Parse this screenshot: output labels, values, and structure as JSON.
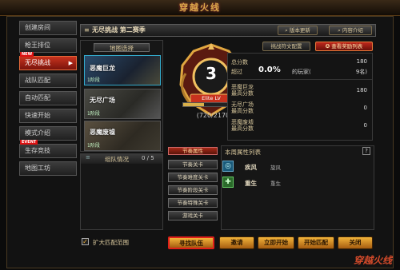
{
  "app": {
    "logo_text": "穿越火线",
    "watermark": "穿越火线"
  },
  "sidebar": {
    "items": [
      {
        "label": "创建房间",
        "badge": ""
      },
      {
        "label": "枪王排位",
        "badge": ""
      },
      {
        "label": "无尽挑战",
        "badge": "NEW",
        "active": true
      },
      {
        "label": "战队匹配",
        "badge": ""
      },
      {
        "label": "自动匹配",
        "badge": ""
      },
      {
        "label": "快速开始",
        "badge": ""
      },
      {
        "label": "模式介绍",
        "badge": ""
      },
      {
        "label": "生存竞技",
        "badge": "EVENT"
      },
      {
        "label": "地图工坊",
        "badge": ""
      }
    ]
  },
  "header": {
    "title": "无尽挑战 第二赛季",
    "news_button": "版本更新",
    "rules_button": "内容介绍"
  },
  "map_select": {
    "title": "地图选择",
    "maps": [
      {
        "name": "恶魔巨龙",
        "difficulty": "1阶段"
      },
      {
        "name": "无尽广场",
        "difficulty": "1阶段"
      },
      {
        "name": "恶魔废墟",
        "difficulty": "1阶段"
      }
    ]
  },
  "rank": {
    "level": "3",
    "level_label": "Elite LV",
    "progress_text": "(720/2170)",
    "progress": 0.33
  },
  "tabs": {
    "challenge_config": "挑战符文配置",
    "reward_list": "查看奖励列表"
  },
  "stats": {
    "total_score_label": "总分数",
    "total_score": "180",
    "exceed_label": "超过",
    "exceed_value": "0.0%",
    "exceed_suffix": "的玩家(",
    "rank_value": "9名)",
    "rows": [
      {
        "label": "恶魔巨龙\n最高分数",
        "value": "180"
      },
      {
        "label": "无尽广场\n最高分数",
        "value": "0"
      },
      {
        "label": "恶魔废墟\n最高分数",
        "value": "0"
      }
    ]
  },
  "team": {
    "title": "组队情况",
    "count": "0 / 5",
    "attr_title": "节奏属性",
    "attr_buttons": [
      "节奏关卡",
      "节奏难度关卡",
      "节奏阶段关卡",
      "节奏特殊关卡",
      "游戏关卡"
    ],
    "member_list_title": "本周属性列表",
    "members": [
      {
        "name": "疾风",
        "desc": "旋风"
      },
      {
        "name": "重生",
        "desc": "重生"
      }
    ]
  },
  "footer": {
    "expand_label": "扩大匹配范围",
    "buttons": [
      "寻找队伍",
      "邀请",
      "立即开始",
      "开始匹配",
      "关闭"
    ]
  },
  "colors": {
    "accent": "#f3b43a",
    "active_tab": "#c8321e",
    "highlight_border": "#e0201a"
  }
}
